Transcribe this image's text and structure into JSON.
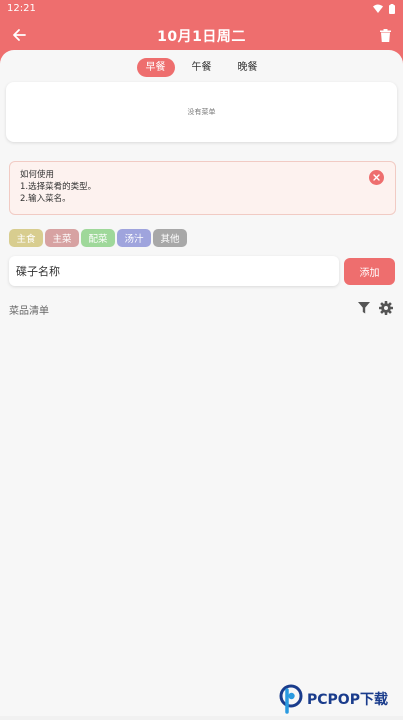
{
  "status_bar": {
    "time": "12:21"
  },
  "app_bar": {
    "title": "10月1日周二"
  },
  "meal_tabs": [
    {
      "label": "早餐",
      "active": true
    },
    {
      "label": "午餐",
      "active": false
    },
    {
      "label": "晚餐",
      "active": false
    }
  ],
  "menu_card": {
    "empty_text": "没有菜单"
  },
  "howto": {
    "title": "如何使用",
    "step1": "1.选择菜肴的类型。",
    "step2": "2.输入菜名。"
  },
  "categories": [
    {
      "label": "主食",
      "color": "#d8cd8f"
    },
    {
      "label": "主菜",
      "color": "#d7a2a2"
    },
    {
      "label": "配菜",
      "color": "#9fd89a"
    },
    {
      "label": "汤汁",
      "color": "#9fa4dd"
    },
    {
      "label": "其他",
      "color": "#a8a8a8"
    }
  ],
  "dish_input": {
    "placeholder": "碟子名称",
    "value": ""
  },
  "add_button": {
    "label": "添加"
  },
  "dish_list": {
    "title": "菜品清单"
  },
  "colors": {
    "primary": "#ee6e6e",
    "sheet": "#f7f7f7"
  },
  "watermark": {
    "text": "PCPOP下载"
  }
}
